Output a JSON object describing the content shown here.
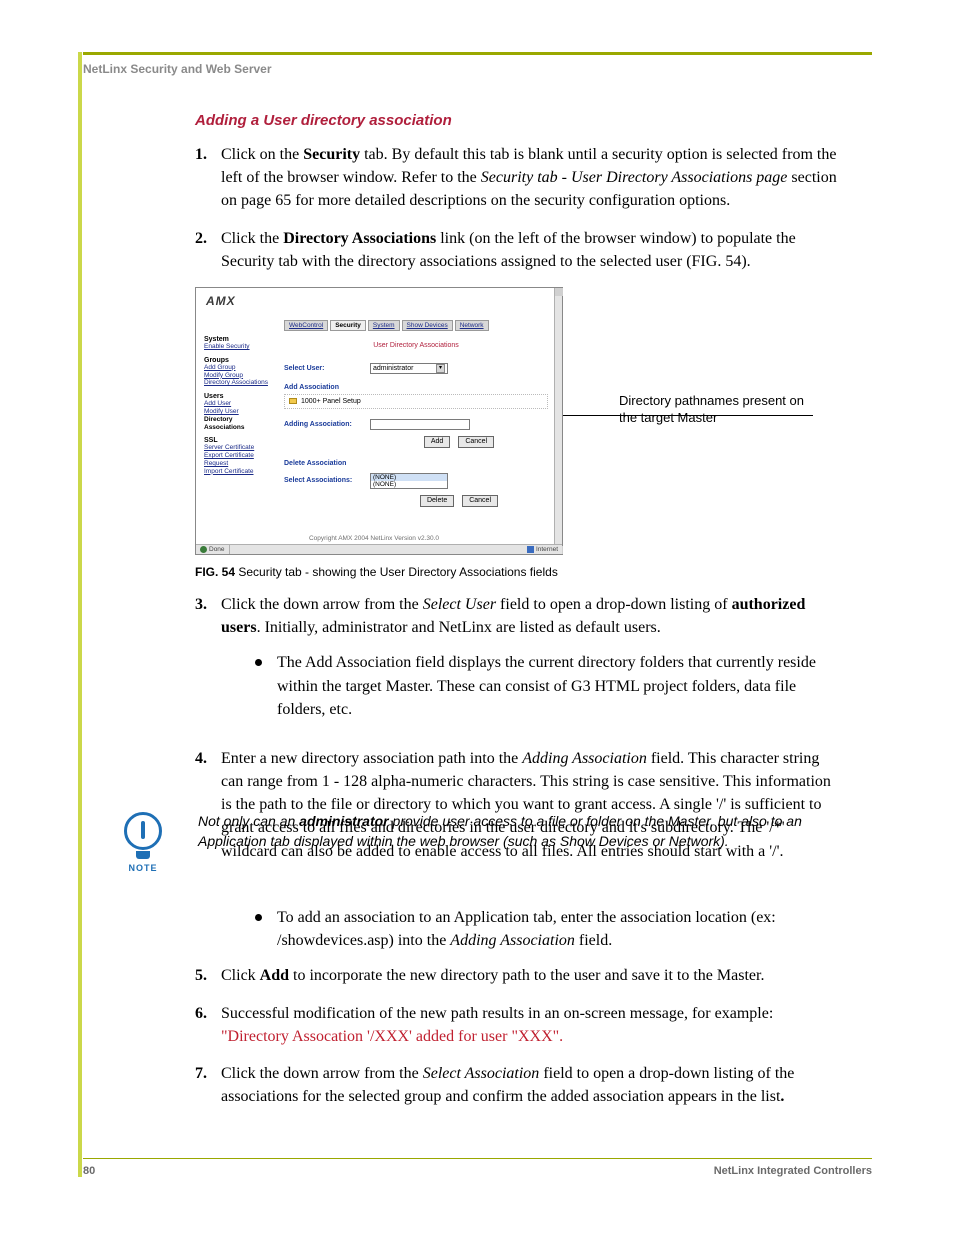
{
  "header": {
    "running": "NetLinx Security and Web Server"
  },
  "section": {
    "title": "Adding a User directory association"
  },
  "steps": {
    "s1": {
      "num": "1.",
      "pre": "Click on the ",
      "bold1": "Security",
      "mid1": " tab. By default this tab is blank until a security option is selected from the left of the browser window. Refer to the ",
      "ital1": "Security tab - User Directory Associations page",
      "post1": " section on page 65 for more detailed descriptions on the security configuration options."
    },
    "s2": {
      "num": "2.",
      "pre": "Click the ",
      "bold1": "Directory Associations",
      "post1": " link (on the left of the browser window) to populate the Security tab with the directory associations assigned to the selected user (FIG. 54)."
    },
    "s3": {
      "num": "3.",
      "pre": "Click the down arrow from the ",
      "ital1": "Select User",
      "mid1": " field to open a drop-down listing of ",
      "bold1": "authorized users",
      "post1": ". Initially, administrator and NetLinx are listed as default users."
    },
    "s3_bullet": "The Add Association field displays the current directory folders that currently reside within the target Master. These can consist of G3 HTML project folders, data file folders, etc.",
    "s4": {
      "num": "4.",
      "pre": "Enter a new directory association path into the ",
      "ital1": "Adding Association",
      "post1": " field. This character string can range from 1 - 128 alpha-numeric characters. This string is case sensitive. This information is the path to the file or directory to which you want to grant access. A single '/' is sufficient to grant access to all files and directories in the user directory and it's subdirectory. The '/*' wildcard can also be added to enable access to all files. All entries should start with a '/'."
    },
    "s5_bullet": {
      "pre": "To add an association to an Application tab, enter the association location (ex: /showdevices.asp) into the ",
      "ital1": "Adding Association",
      "post1": " field."
    },
    "s5": {
      "num": "5.",
      "pre": "Click ",
      "bold1": "Add",
      "post1": " to incorporate the new directory path to the user and save it to the Master."
    },
    "s6": {
      "num": "6.",
      "line1": "Successful modification of the new path results in an on-screen message, for example:",
      "line2": "\"Directory Assocation '/XXX' added for user \"XXX\"."
    },
    "s7": {
      "num": "7.",
      "pre": "Click the down arrow from the ",
      "ital1": "Select Association",
      "mid1": " field to open a drop-down listing of the associations for the selected group and confirm the added association appears in the list",
      "bold1": "."
    }
  },
  "note": {
    "label": "NOTE",
    "t1": "Not only can an ",
    "b1": "administrator",
    "t2": " provide user access to a file or folder on the Master, but also to an Application tab displayed within the web browser (such as Show Devices or Network)."
  },
  "figure": {
    "caption_b": "FIG. 54",
    "caption_r": "  Security tab - showing the User Directory Associations fields",
    "callout": "Directory pathnames present on the target Master",
    "logo": "AMX",
    "tabs": {
      "webcontrol": "WebControl",
      "security": "Security",
      "system": "System",
      "showdevices": "Show Devices",
      "network": "Network"
    },
    "sidebar": {
      "g1_h": "System",
      "g1_a": "Enable Security",
      "g2_h": "Groups",
      "g2_a": "Add Group",
      "g2_b": "Modify Group",
      "g2_c": "Directory Associations",
      "g3_h": "Users",
      "g3_a": "Add User",
      "g3_b": "Modify User",
      "g3_c": "Directory Associations",
      "g4_h": "SSL",
      "g4_a": "Server Certificate",
      "g4_b": "Export Certificate Request",
      "g4_c": "Import Certificate"
    },
    "panel": {
      "title": "User Directory Associations",
      "select_user_lbl": "Select User:",
      "select_user_val": "administrator",
      "add_hd": "Add Association",
      "folder_item": "1000+ Panel Setup",
      "adding_lbl": "Adding Association:",
      "btn_add": "Add",
      "btn_cancel": "Cancel",
      "del_hd": "Delete Association",
      "sel_assoc_lbl": "Select Associations:",
      "opt_none": "(NONE)",
      "btn_delete": "Delete",
      "btn_cancel2": "Cancel",
      "copyright": "Copyright AMX 2004   NetLinx Version v2.30.0"
    },
    "status": {
      "done": "Done",
      "internet": "Internet"
    }
  },
  "footer": {
    "page": "80",
    "title": "NetLinx Integrated Controllers"
  }
}
